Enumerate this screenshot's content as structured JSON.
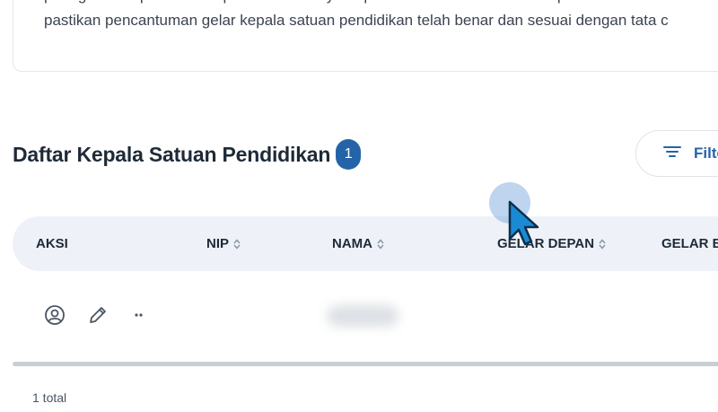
{
  "info": {
    "lines": [
      "penugasan kepala satuan pendidikan hanya dapat dilakukan oleh Admin Dapodik Dinas melal",
      "pastikan pencantuman gelar kepala satuan pendidikan telah benar dan sesuai dengan tata c"
    ]
  },
  "section": {
    "title": "Daftar Kepala Satuan Pendidikan",
    "count": "1"
  },
  "filter": {
    "label": "Filte",
    "icon": "filter-lines-icon"
  },
  "table": {
    "columns": [
      {
        "key": "aksi",
        "label": "AKSI",
        "sortable": false
      },
      {
        "key": "nip",
        "label": "NIP",
        "sortable": true
      },
      {
        "key": "nama",
        "label": "NAMA",
        "sortable": true
      },
      {
        "key": "gelar_depan",
        "label": "GELAR DEPAN",
        "sortable": true
      },
      {
        "key": "gelar_belakang",
        "label": "GELAR B",
        "sortable": true
      }
    ],
    "rows": [
      {
        "actions": [
          "user-circle-icon",
          "pencil-icon",
          "more-dots-icon"
        ],
        "nip": "",
        "nama": "",
        "gelar_depan": "",
        "nama_blurred": true
      }
    ]
  },
  "footer": {
    "total": "1 total"
  },
  "colors": {
    "accent": "#2563a8",
    "header_bg": "#eef2f8",
    "text": "#1f2a37"
  }
}
